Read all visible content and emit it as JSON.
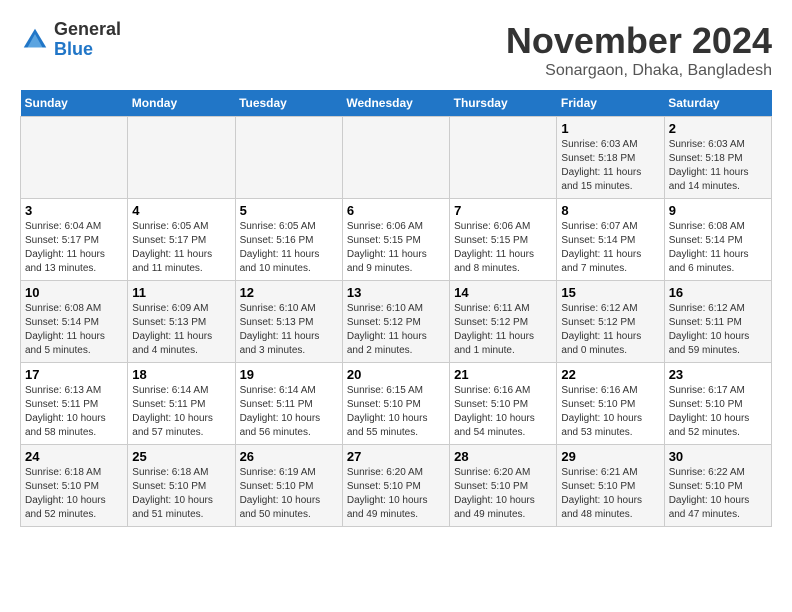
{
  "logo": {
    "general": "General",
    "blue": "Blue"
  },
  "header": {
    "month": "November 2024",
    "location": "Sonargaon, Dhaka, Bangladesh"
  },
  "weekdays": [
    "Sunday",
    "Monday",
    "Tuesday",
    "Wednesday",
    "Thursday",
    "Friday",
    "Saturday"
  ],
  "weeks": [
    [
      {
        "day": "",
        "info": ""
      },
      {
        "day": "",
        "info": ""
      },
      {
        "day": "",
        "info": ""
      },
      {
        "day": "",
        "info": ""
      },
      {
        "day": "",
        "info": ""
      },
      {
        "day": "1",
        "info": "Sunrise: 6:03 AM\nSunset: 5:18 PM\nDaylight: 11 hours\nand 15 minutes."
      },
      {
        "day": "2",
        "info": "Sunrise: 6:03 AM\nSunset: 5:18 PM\nDaylight: 11 hours\nand 14 minutes."
      }
    ],
    [
      {
        "day": "3",
        "info": "Sunrise: 6:04 AM\nSunset: 5:17 PM\nDaylight: 11 hours\nand 13 minutes."
      },
      {
        "day": "4",
        "info": "Sunrise: 6:05 AM\nSunset: 5:17 PM\nDaylight: 11 hours\nand 11 minutes."
      },
      {
        "day": "5",
        "info": "Sunrise: 6:05 AM\nSunset: 5:16 PM\nDaylight: 11 hours\nand 10 minutes."
      },
      {
        "day": "6",
        "info": "Sunrise: 6:06 AM\nSunset: 5:15 PM\nDaylight: 11 hours\nand 9 minutes."
      },
      {
        "day": "7",
        "info": "Sunrise: 6:06 AM\nSunset: 5:15 PM\nDaylight: 11 hours\nand 8 minutes."
      },
      {
        "day": "8",
        "info": "Sunrise: 6:07 AM\nSunset: 5:14 PM\nDaylight: 11 hours\nand 7 minutes."
      },
      {
        "day": "9",
        "info": "Sunrise: 6:08 AM\nSunset: 5:14 PM\nDaylight: 11 hours\nand 6 minutes."
      }
    ],
    [
      {
        "day": "10",
        "info": "Sunrise: 6:08 AM\nSunset: 5:14 PM\nDaylight: 11 hours\nand 5 minutes."
      },
      {
        "day": "11",
        "info": "Sunrise: 6:09 AM\nSunset: 5:13 PM\nDaylight: 11 hours\nand 4 minutes."
      },
      {
        "day": "12",
        "info": "Sunrise: 6:10 AM\nSunset: 5:13 PM\nDaylight: 11 hours\nand 3 minutes."
      },
      {
        "day": "13",
        "info": "Sunrise: 6:10 AM\nSunset: 5:12 PM\nDaylight: 11 hours\nand 2 minutes."
      },
      {
        "day": "14",
        "info": "Sunrise: 6:11 AM\nSunset: 5:12 PM\nDaylight: 11 hours\nand 1 minute."
      },
      {
        "day": "15",
        "info": "Sunrise: 6:12 AM\nSunset: 5:12 PM\nDaylight: 11 hours\nand 0 minutes."
      },
      {
        "day": "16",
        "info": "Sunrise: 6:12 AM\nSunset: 5:11 PM\nDaylight: 10 hours\nand 59 minutes."
      }
    ],
    [
      {
        "day": "17",
        "info": "Sunrise: 6:13 AM\nSunset: 5:11 PM\nDaylight: 10 hours\nand 58 minutes."
      },
      {
        "day": "18",
        "info": "Sunrise: 6:14 AM\nSunset: 5:11 PM\nDaylight: 10 hours\nand 57 minutes."
      },
      {
        "day": "19",
        "info": "Sunrise: 6:14 AM\nSunset: 5:11 PM\nDaylight: 10 hours\nand 56 minutes."
      },
      {
        "day": "20",
        "info": "Sunrise: 6:15 AM\nSunset: 5:10 PM\nDaylight: 10 hours\nand 55 minutes."
      },
      {
        "day": "21",
        "info": "Sunrise: 6:16 AM\nSunset: 5:10 PM\nDaylight: 10 hours\nand 54 minutes."
      },
      {
        "day": "22",
        "info": "Sunrise: 6:16 AM\nSunset: 5:10 PM\nDaylight: 10 hours\nand 53 minutes."
      },
      {
        "day": "23",
        "info": "Sunrise: 6:17 AM\nSunset: 5:10 PM\nDaylight: 10 hours\nand 52 minutes."
      }
    ],
    [
      {
        "day": "24",
        "info": "Sunrise: 6:18 AM\nSunset: 5:10 PM\nDaylight: 10 hours\nand 52 minutes."
      },
      {
        "day": "25",
        "info": "Sunrise: 6:18 AM\nSunset: 5:10 PM\nDaylight: 10 hours\nand 51 minutes."
      },
      {
        "day": "26",
        "info": "Sunrise: 6:19 AM\nSunset: 5:10 PM\nDaylight: 10 hours\nand 50 minutes."
      },
      {
        "day": "27",
        "info": "Sunrise: 6:20 AM\nSunset: 5:10 PM\nDaylight: 10 hours\nand 49 minutes."
      },
      {
        "day": "28",
        "info": "Sunrise: 6:20 AM\nSunset: 5:10 PM\nDaylight: 10 hours\nand 49 minutes."
      },
      {
        "day": "29",
        "info": "Sunrise: 6:21 AM\nSunset: 5:10 PM\nDaylight: 10 hours\nand 48 minutes."
      },
      {
        "day": "30",
        "info": "Sunrise: 6:22 AM\nSunset: 5:10 PM\nDaylight: 10 hours\nand 47 minutes."
      }
    ]
  ]
}
